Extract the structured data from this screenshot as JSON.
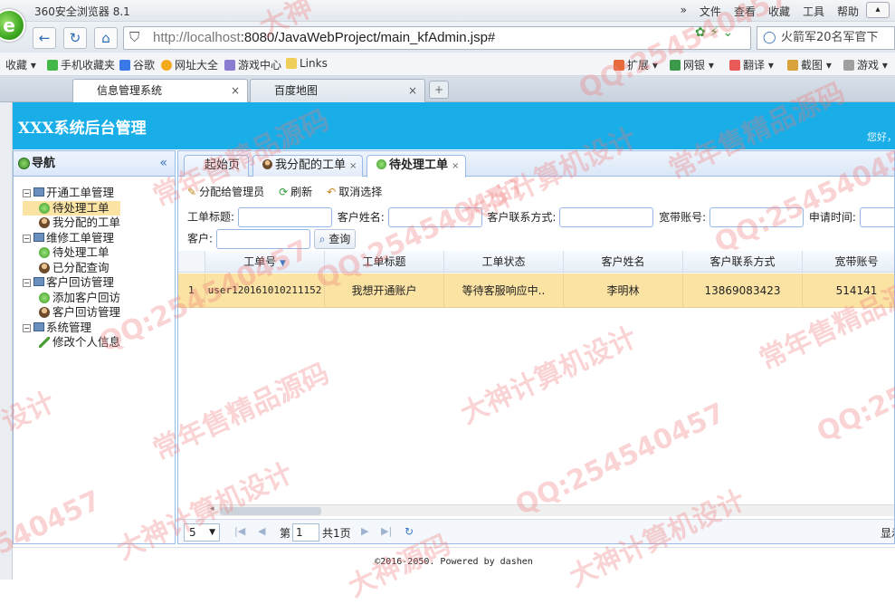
{
  "browser": {
    "app_title": "360安全浏览器 8.1",
    "menu": [
      "»",
      "文件",
      "查看",
      "收藏",
      "工具",
      "帮助"
    ],
    "url_host": "http://localhost",
    "url_rest": ":8080/JavaWebProject/main_kfAdmin.jsp#",
    "search_text": "火箭军20名军官下",
    "bookmarks": [
      "收藏",
      "手机收藏夹",
      "谷歌",
      "网址大全",
      "游戏中心",
      "Links",
      "扩展",
      "网银",
      "翻译",
      "截图",
      "游戏"
    ],
    "tabs": [
      {
        "label": "信息管理系统",
        "close": "×"
      },
      {
        "label": "百度地图",
        "close": "×"
      }
    ],
    "new_tab": "+"
  },
  "app": {
    "title": "XXX系统后台管理",
    "greeting": "您好，"
  },
  "nav": {
    "title": "导航",
    "collapse": "«",
    "groups": [
      {
        "label": "开通工单管理",
        "items": [
          "待处理工单",
          "我分配的工单"
        ]
      },
      {
        "label": "维修工单管理",
        "items": [
          "待处理工单",
          "已分配查询"
        ]
      },
      {
        "label": "客户回访管理",
        "items": [
          "添加客户回访",
          "客户回访管理"
        ]
      },
      {
        "label": "系统管理",
        "items": [
          "修改个人信息"
        ]
      }
    ]
  },
  "main": {
    "tabs": [
      {
        "label": "起始页",
        "close": ""
      },
      {
        "label": "我分配的工单",
        "close": "×"
      },
      {
        "label": "待处理工单",
        "close": "×"
      }
    ],
    "toolbar": [
      "分配给管理员",
      "刷新",
      "取消选择"
    ],
    "filters": {
      "title_label": "工单标题:",
      "cust_name_label": "客户姓名:",
      "cust_contact_label": "客户联系方式:",
      "broadband_label": "宽带账号:",
      "apply_time_label": "申请时间:",
      "customer_label": "客户:",
      "query_button": "查询"
    },
    "grid": {
      "columns": [
        "工单号",
        "工单标题",
        "工单状态",
        "客户姓名",
        "客户联系方式",
        "宽带账号"
      ],
      "sort_indicator": "▼",
      "rows": [
        {
          "num": "1",
          "cells": [
            "user120161010211152",
            "我想开通账户",
            "等待客服响应中..",
            "李明林",
            "13869083423",
            "514141"
          ]
        }
      ]
    },
    "pager": {
      "page_size": "5",
      "page_prefix": "第",
      "page_value": "1",
      "page_total": "共1页",
      "display": "显示"
    }
  },
  "footer": "©2016-2050. Powered by dashen",
  "watermarks": [
    "大神",
    "QQ:254540457",
    "常年售精品源码",
    "大神计算机设计",
    "QQ:254540457",
    "常年售精品源码",
    "QQ:254540457",
    "大神计算机设计",
    "常年售精品源码",
    "QQ:254540457",
    "设计",
    "QQ:254540457",
    "常年售精品源码",
    "大神计算机设计",
    "QQ:25",
    "540457",
    "大神源码",
    "大神计算机设计"
  ]
}
